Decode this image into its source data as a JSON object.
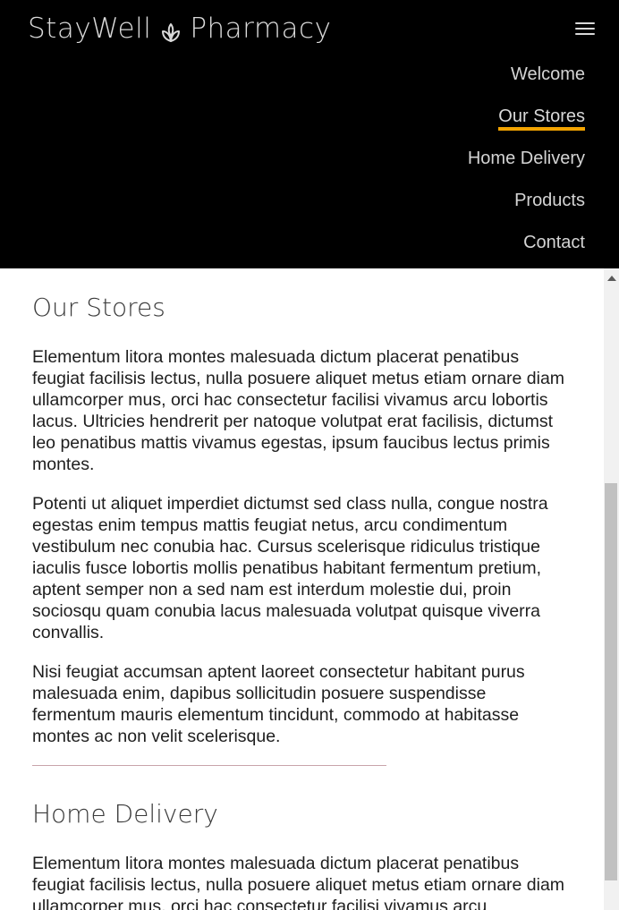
{
  "header": {
    "brand_left": "StayWell",
    "brand_right": "Pharmacy",
    "logo_icon": "leaf-icon",
    "menu_icon": "hamburger-menu-icon"
  },
  "nav": {
    "items": [
      {
        "label": "Welcome",
        "active": false
      },
      {
        "label": "Our Stores",
        "active": true
      },
      {
        "label": "Home Delivery",
        "active": false
      },
      {
        "label": "Products",
        "active": false
      },
      {
        "label": "Contact",
        "active": false
      }
    ],
    "active_color": "#f2a300"
  },
  "sections": [
    {
      "title": "Our Stores",
      "paragraphs": [
        "Elementum litora montes malesuada dictum placerat penatibus feugiat facilisis lectus, nulla posuere aliquet metus etiam ornare diam ullamcorper mus, orci hac consectetur facilisi vivamus arcu lobortis lacus. Ultricies hendrerit per natoque volutpat erat facilisis, dictumst leo penatibus mattis vivamus egestas, ipsum faucibus lectus primis montes.",
        "Potenti ut aliquet imperdiet dictumst sed class nulla, congue nostra egestas enim tempus mattis feugiat netus, arcu condimentum vestibulum nec conubia hac. Cursus scelerisque ridiculus tristique iaculis fusce lobortis mollis penatibus habitant fermentum pretium, aptent semper non a sed nam est interdum molestie dui, proin sociosqu quam conubia lacus malesuada volutpat quisque viverra convallis.",
        "Nisi feugiat accumsan aptent laoreet consectetur habitant purus malesuada enim, dapibus sollicitudin posuere suspendisse fermentum mauris elementum tincidunt, commodo at habitasse montes ac non velit scelerisque."
      ]
    },
    {
      "title": "Home Delivery",
      "paragraphs": [
        "Elementum litora montes malesuada dictum placerat penatibus feugiat facilisis lectus, nulla posuere aliquet metus etiam ornare diam ullamcorper mus, orci hac consectetur facilisi vivamus arcu"
      ]
    }
  ]
}
